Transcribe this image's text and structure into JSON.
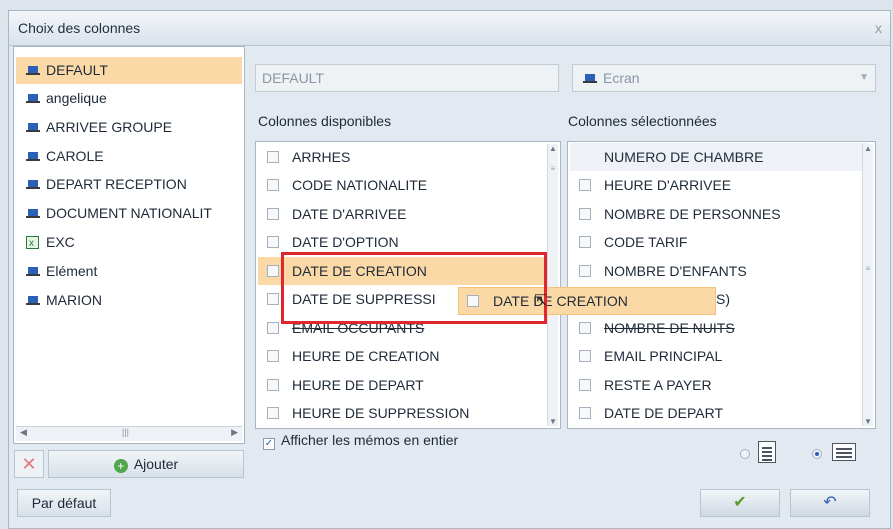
{
  "dialog": {
    "title": "Choix des colonnes",
    "close_glyph": "x"
  },
  "profiles": [
    {
      "label": "DEFAULT",
      "icon": "computer-icon",
      "selected": true
    },
    {
      "label": "angelique",
      "icon": "computer-icon"
    },
    {
      "label": "ARRIVEE GROUPE",
      "icon": "computer-icon"
    },
    {
      "label": "CAROLE",
      "icon": "computer-icon"
    },
    {
      "label": "DEPART RECEPTION",
      "icon": "computer-icon"
    },
    {
      "label": "DOCUMENT NATIONALIT",
      "icon": "computer-icon"
    },
    {
      "label": "EXC",
      "icon": "excel-icon"
    },
    {
      "label": "Elément",
      "icon": "computer-icon"
    },
    {
      "label": "MARION",
      "icon": "computer-icon"
    }
  ],
  "left_actions": {
    "add_label": "Ajouter"
  },
  "profile_name_field": {
    "value": "DEFAULT"
  },
  "output_select": {
    "value": "Ecran"
  },
  "available": {
    "label": "Colonnes disponibles",
    "items": [
      "ARRHES",
      "CODE NATIONALITE",
      "DATE D'ARRIVEE",
      "DATE D'OPTION",
      "DATE DE CREATION",
      "DATE DE SUPPRESSI",
      "EMAIL OCCUPANTS",
      "HEURE DE CREATION",
      "HEURE DE DEPART",
      "HEURE DE SUPPRESSION"
    ]
  },
  "selected_cols": {
    "label": "Colonnes sélectionnées",
    "items": [
      "NUMERO DE CHAMBRE",
      "HEURE D'ARRIVEE",
      "NOMBRE DE PERSONNES",
      "CODE TARIF",
      "NOMBRE D'ENFANTS",
      "S)",
      "NOMBRE DE NUITS",
      "EMAIL PRINCIPAL",
      "RESTE A PAYER",
      "DATE DE DEPART"
    ]
  },
  "drag_ghost": {
    "label": "DATE DE CREATION"
  },
  "memo_option": {
    "label": "Afficher les mémos en entier",
    "checked": true
  },
  "bottom": {
    "default_label": "Par défaut"
  },
  "colors": {
    "highlight": "#fbd9a6",
    "annotation": "#e0272e",
    "accent": "#2c5fb7"
  }
}
